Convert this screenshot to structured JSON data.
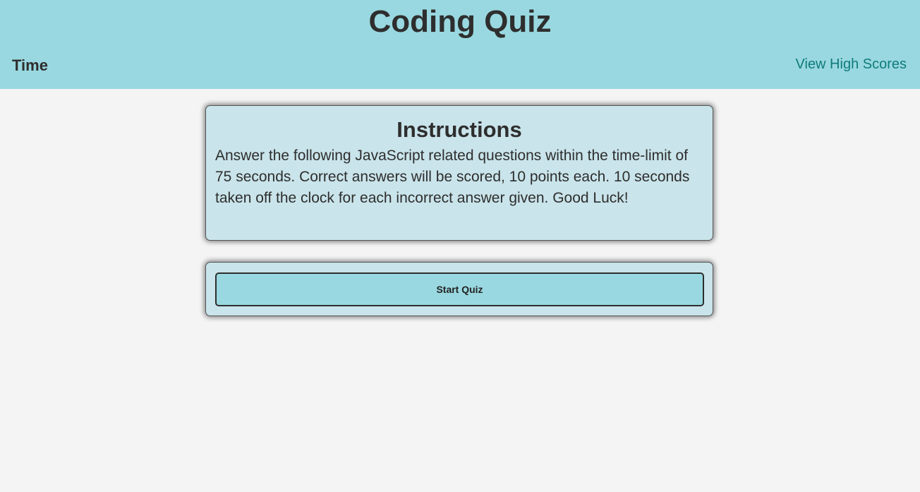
{
  "header": {
    "title": "Coding Quiz",
    "time_label": "Time",
    "highscores_link": "View High Scores"
  },
  "instructions": {
    "heading": "Instructions",
    "body": "Answer the following JavaScript related questions within the time-limit of 75 seconds. Correct answers will be scored, 10 points each. 10 seconds taken off the clock for each incorrect answer given. Good Luck!"
  },
  "start": {
    "button_label": "Start Quiz"
  },
  "colors": {
    "header_bg": "#99d8e0",
    "page_bg": "#f4f4f4",
    "card_bg": "#c9e4ea",
    "link": "#0f7b7b",
    "button_bg": "#99d8e0"
  }
}
